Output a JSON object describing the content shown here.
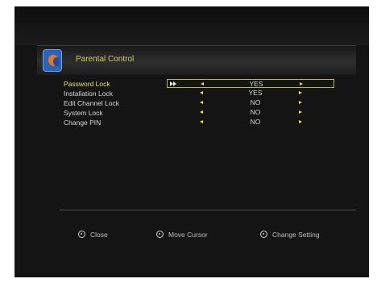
{
  "header": {
    "title": "Parental Control",
    "logo_icon": "menu-logo-icon"
  },
  "settings": [
    {
      "label": "Password Lock",
      "value": "YES",
      "selected": true
    },
    {
      "label": "Installation Lock",
      "value": "YES",
      "selected": false
    },
    {
      "label": "Edit Channel Lock",
      "value": "NO",
      "selected": false
    },
    {
      "label": "System Lock",
      "value": "NO",
      "selected": false
    },
    {
      "label": "Change PIN",
      "value": "NO",
      "selected": false
    }
  ],
  "footer": {
    "close_label": "Close",
    "move_cursor_label": "Move Cursor",
    "change_setting_label": "Change Setting"
  },
  "colors": {
    "accent": "#e4e35a",
    "title": "#c9cf63",
    "background": "#141414",
    "selection_border": "#b9bd2f"
  }
}
